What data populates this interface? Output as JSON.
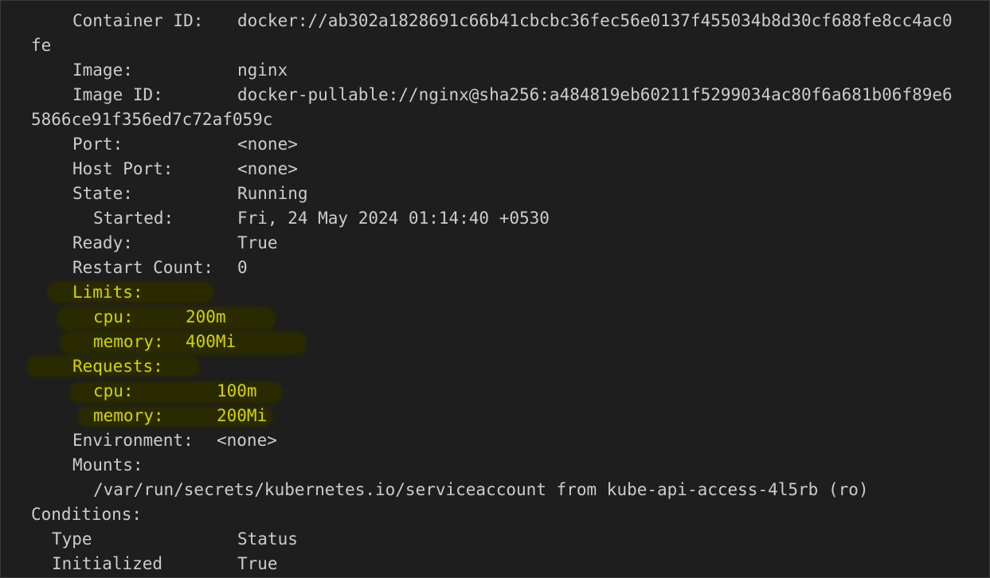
{
  "colors": {
    "background": "#1e1e1e",
    "text": "#cccccc",
    "highlight_text": "#d4d400",
    "marker": "#2b2b00"
  },
  "lines": {
    "container_id": {
      "label": "Container ID:",
      "value": "docker://ab302a1828691c66b41cbcbc36fec56e0137f455034b8d30cf688fe8cc4ac0",
      "value_cont": "fe"
    },
    "image": {
      "label": "Image:",
      "value": "nginx"
    },
    "image_id": {
      "label": "Image ID:",
      "value": "docker-pullable://nginx@sha256:a484819eb60211f5299034ac80f6a681b06f89e6",
      "value_cont": "5866ce91f356ed7c72af059c"
    },
    "port": {
      "label": "Port:",
      "value": "<none>"
    },
    "host_port": {
      "label": "Host Port:",
      "value": "<none>"
    },
    "state": {
      "label": "State:",
      "value": "Running"
    },
    "started": {
      "label": "Started:",
      "value": "Fri, 24 May 2024 01:14:40 +0530"
    },
    "ready": {
      "label": "Ready:",
      "value": "True"
    },
    "restart_count": {
      "label": "Restart Count:",
      "value": "0"
    },
    "limits": {
      "label": "Limits:",
      "cpu_label": "cpu:",
      "cpu_value": "200m",
      "memory_label": "memory:",
      "memory_value": "400Mi"
    },
    "requests": {
      "label": "Requests:",
      "cpu_label": "cpu:",
      "cpu_value": "100m",
      "memory_label": "memory:",
      "memory_value": "200Mi"
    },
    "environment": {
      "label": "Environment:",
      "value": "<none>"
    },
    "mounts": {
      "label": "Mounts:",
      "value": "/var/run/secrets/kubernetes.io/serviceaccount from kube-api-access-4l5rb (ro)"
    },
    "conditions": {
      "label": "Conditions:",
      "col_type": "Type",
      "col_status": "Status",
      "row_type": "Initialized",
      "row_status": "True"
    }
  }
}
